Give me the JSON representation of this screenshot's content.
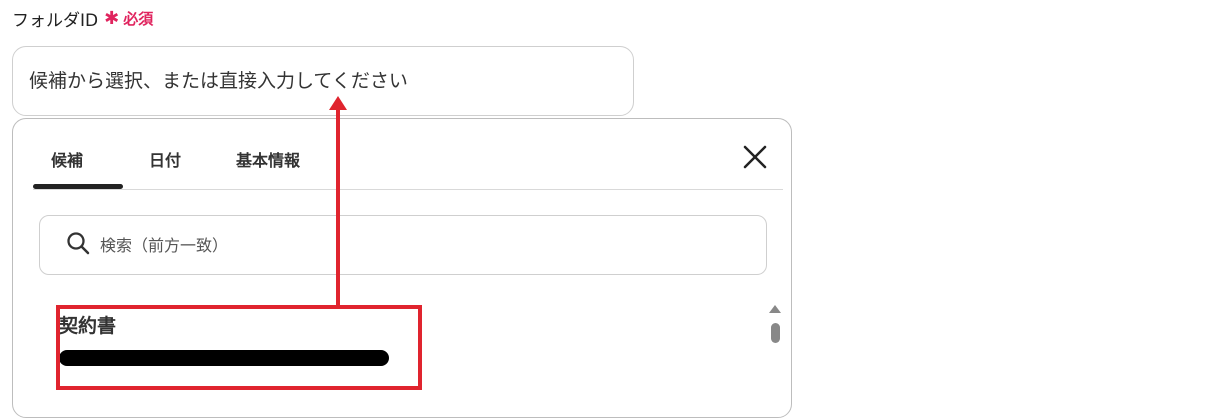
{
  "field": {
    "label": "フォルダID",
    "required_star": "✱",
    "required_text": "必須",
    "placeholder": "候補から選択、または直接入力してください"
  },
  "tabs": [
    {
      "label": "候補",
      "active": true
    },
    {
      "label": "日付",
      "active": false
    },
    {
      "label": "基本情報",
      "active": false
    }
  ],
  "search": {
    "placeholder": "検索（前方一致）"
  },
  "list": {
    "items": [
      {
        "title": "契約書"
      }
    ]
  },
  "colors": {
    "accent_red": "#e0242e",
    "required_pink": "#e0245e"
  }
}
